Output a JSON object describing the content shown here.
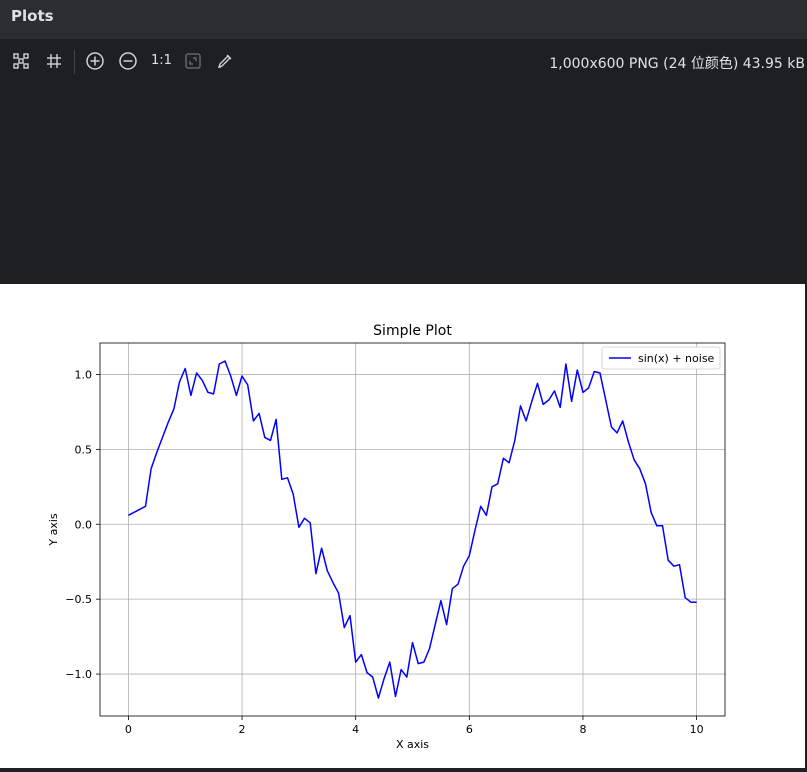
{
  "window": {
    "title": "Plots"
  },
  "toolbar": {
    "zoom_label": "1:1",
    "image_info": "1,000x600 PNG (24 位颜色) 43.95 kB",
    "buttons": [
      "fit-icon",
      "grid-icon",
      "zoom-in-icon",
      "zoom-out-icon",
      "actual-size",
      "fit-window-icon",
      "color-picker-icon"
    ]
  },
  "chart_data": {
    "type": "line",
    "title": "Simple Plot",
    "xlabel": "X axis",
    "ylabel": "Y axis",
    "xlim": [
      -0.5,
      10.5
    ],
    "ylim": [
      -1.28,
      1.21
    ],
    "xticks": [
      0,
      2,
      4,
      6,
      8,
      10
    ],
    "yticks": [
      -1.0,
      -0.5,
      0.0,
      0.5,
      1.0
    ],
    "xtick_labels": [
      "0",
      "2",
      "4",
      "6",
      "8",
      "10"
    ],
    "ytick_labels": [
      "−1.0",
      "−0.5",
      "0.0",
      "0.5",
      "1.0"
    ],
    "grid": true,
    "legend": "top-right",
    "series": [
      {
        "name": "sin(x) + noise",
        "color": "#0000ff",
        "x": [
          0.0,
          0.1,
          0.2,
          0.3,
          0.4,
          0.5,
          0.6,
          0.7,
          0.8,
          0.9,
          1.0,
          1.1,
          1.2,
          1.3,
          1.4,
          1.5,
          1.6,
          1.7,
          1.8,
          1.9,
          2.0,
          2.1,
          2.2,
          2.3,
          2.4,
          2.5,
          2.6,
          2.7,
          2.8,
          2.9,
          3.0,
          3.1,
          3.2,
          3.3,
          3.4,
          3.5,
          3.6,
          3.7,
          3.8,
          3.9,
          4.0,
          4.1,
          4.2,
          4.3,
          4.4,
          4.5,
          4.6,
          4.7,
          4.8,
          4.9,
          5.0,
          5.1,
          5.2,
          5.3,
          5.4,
          5.5,
          5.6,
          5.7,
          5.8,
          5.9,
          6.0,
          6.1,
          6.2,
          6.3,
          6.4,
          6.5,
          6.6,
          6.7,
          6.8,
          6.9,
          7.0,
          7.1,
          7.2,
          7.3,
          7.4,
          7.5,
          7.6,
          7.7,
          7.8,
          7.9,
          8.0,
          8.1,
          8.2,
          8.3,
          8.4,
          8.5,
          8.6,
          8.7,
          8.8,
          8.9,
          9.0,
          9.1,
          9.2,
          9.3,
          9.4,
          9.5,
          9.6,
          9.7,
          9.8,
          9.9,
          10.0
        ],
        "y": [
          0.06,
          0.08,
          0.1,
          0.12,
          0.37,
          0.48,
          0.58,
          0.68,
          0.77,
          0.95,
          1.04,
          0.86,
          1.01,
          0.96,
          0.88,
          0.87,
          1.07,
          1.09,
          0.99,
          0.86,
          0.99,
          0.93,
          0.69,
          0.74,
          0.58,
          0.56,
          0.7,
          0.3,
          0.31,
          0.2,
          -0.02,
          0.04,
          0.01,
          -0.33,
          -0.16,
          -0.31,
          -0.39,
          -0.46,
          -0.69,
          -0.61,
          -0.92,
          -0.87,
          -0.99,
          -1.02,
          -1.16,
          -1.03,
          -0.92,
          -1.15,
          -0.97,
          -1.02,
          -0.79,
          -0.93,
          -0.92,
          -0.83,
          -0.67,
          -0.51,
          -0.67,
          -0.43,
          -0.4,
          -0.28,
          -0.21,
          -0.04,
          0.12,
          0.06,
          0.25,
          0.27,
          0.44,
          0.41,
          0.56,
          0.79,
          0.69,
          0.82,
          0.94,
          0.8,
          0.83,
          0.89,
          0.78,
          1.07,
          0.82,
          1.03,
          0.88,
          0.91,
          1.02,
          1.01,
          0.83,
          0.65,
          0.61,
          0.69,
          0.55,
          0.43,
          0.37,
          0.27,
          0.08,
          -0.01,
          -0.01,
          -0.24,
          -0.28,
          -0.27,
          -0.49,
          -0.52,
          -0.52
        ]
      }
    ]
  }
}
